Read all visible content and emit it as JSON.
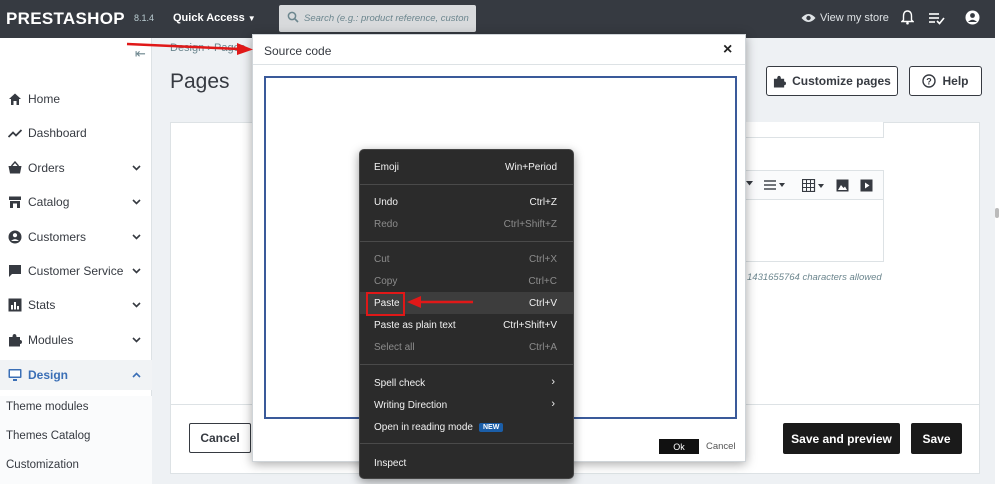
{
  "topbar": {
    "logo": "PRESTASHOP",
    "version": "8.1.4",
    "quick_access": "Quick Access",
    "search_placeholder": "Search (e.g.: product reference, custon",
    "view_store": "View my store",
    "icons": [
      "eye-icon",
      "bell-icon",
      "checklist-icon",
      "user-icon"
    ]
  },
  "sidebar": {
    "items": [
      {
        "label": "Home",
        "icon": "home-icon"
      },
      {
        "label": "Dashboard",
        "icon": "trend-icon"
      },
      {
        "label": "Orders",
        "icon": "basket-icon"
      },
      {
        "label": "Catalog",
        "icon": "store-icon"
      },
      {
        "label": "Customers",
        "icon": "account-icon"
      },
      {
        "label": "Customer Service",
        "icon": "chat-icon"
      },
      {
        "label": "Stats",
        "icon": "bar-chart-icon"
      },
      {
        "label": "Modules",
        "icon": "puzzle-icon"
      },
      {
        "label": "Design",
        "icon": "desktop-icon"
      }
    ],
    "subitems": [
      "Theme modules",
      "Themes Catalog",
      "Customization"
    ]
  },
  "header": {
    "breadcrumb": "Design › Pages",
    "title": "Pages",
    "customize_label": "Customize pages",
    "help_label": "Help"
  },
  "form": {
    "chars_allowed": "1431655764 characters allowed",
    "cancel_label": "Cancel",
    "save_preview_label": "Save and preview",
    "save_label": "Save"
  },
  "modal": {
    "title": "Source code",
    "close": "×",
    "ok_label": "Ok",
    "cancel_label": "Cancel"
  },
  "context_menu": {
    "emoji": {
      "label": "Emoji",
      "shortcut": "Win+Period"
    },
    "undo": {
      "label": "Undo",
      "shortcut": "Ctrl+Z"
    },
    "redo": {
      "label": "Redo",
      "shortcut": "Ctrl+Shift+Z"
    },
    "cut": {
      "label": "Cut",
      "shortcut": "Ctrl+X"
    },
    "copy": {
      "label": "Copy",
      "shortcut": "Ctrl+C"
    },
    "paste": {
      "label": "Paste",
      "shortcut": "Ctrl+V"
    },
    "paste_plain": {
      "label": "Paste as plain text",
      "shortcut": "Ctrl+Shift+V"
    },
    "select_all": {
      "label": "Select all",
      "shortcut": "Ctrl+A"
    },
    "spell_check": {
      "label": "Spell check",
      "arrow": "›"
    },
    "writing_direction": {
      "label": "Writing Direction",
      "arrow": "›"
    },
    "reading_mode": {
      "label": "Open in reading mode",
      "badge": "NEW"
    },
    "inspect": {
      "label": "Inspect"
    }
  },
  "colors": {
    "topbar": "#363a41",
    "annotation": "#e01818",
    "active_nav": "#3b6fb6",
    "menu_bg": "#2b2b2b"
  }
}
